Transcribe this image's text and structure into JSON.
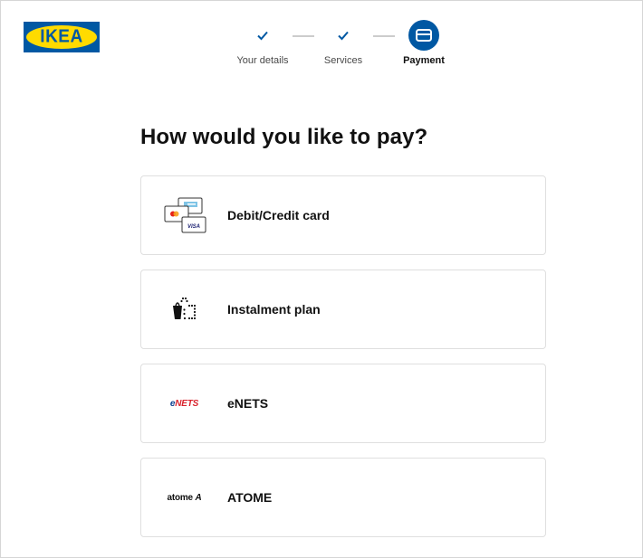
{
  "brand": {
    "logo_text": "IKEA"
  },
  "stepper": {
    "steps": [
      {
        "label": "Your details",
        "state": "done"
      },
      {
        "label": "Services",
        "state": "done"
      },
      {
        "label": "Payment",
        "state": "active"
      }
    ]
  },
  "main": {
    "heading": "How would you like to pay?",
    "payment_options": [
      {
        "label": "Debit/Credit card",
        "icon": "cards-icon"
      },
      {
        "label": "Instalment plan",
        "icon": "instalment-bag-icon"
      },
      {
        "label": "eNETS",
        "icon": "enets-logo",
        "logo_text": "eNETS"
      },
      {
        "label": "ATOME",
        "icon": "atome-logo",
        "logo_text": "atome A"
      }
    ]
  },
  "colors": {
    "brand_blue": "#0058a3",
    "brand_yellow": "#ffdb00",
    "enets_red": "#d9232d",
    "enets_blue": "#0a3f8f",
    "border": "#dfdfdf"
  }
}
